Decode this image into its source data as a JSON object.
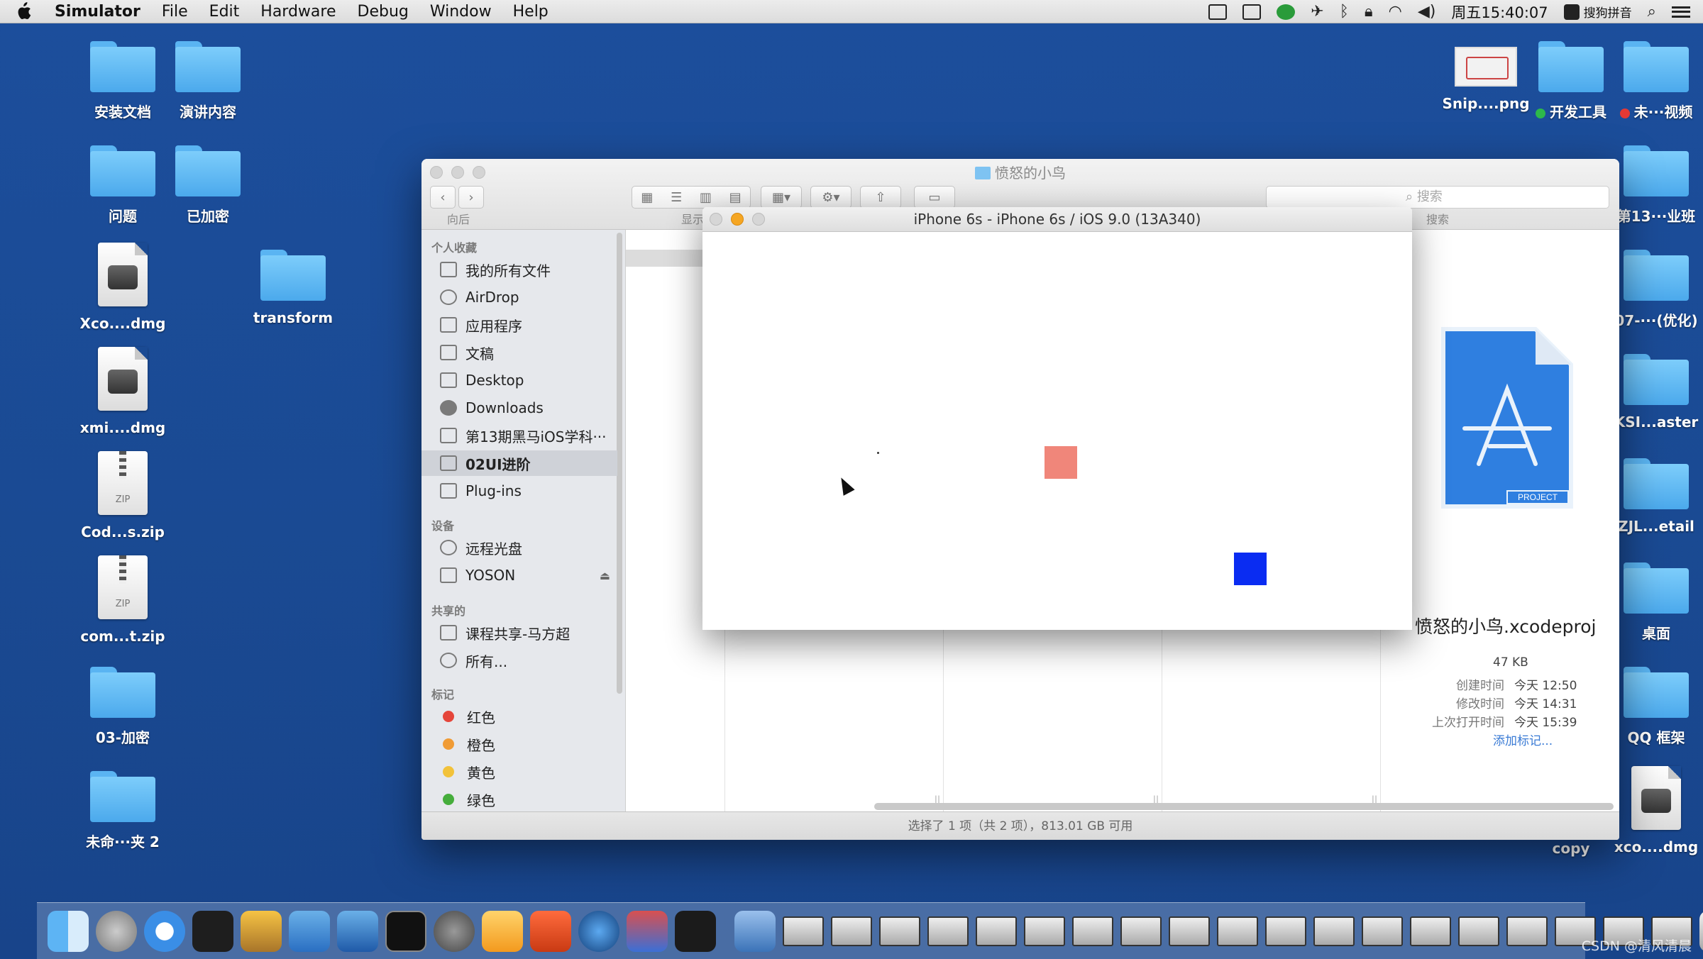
{
  "menubar": {
    "app": "Simulator",
    "items": [
      "File",
      "Edit",
      "Hardware",
      "Debug",
      "Window",
      "Help"
    ],
    "clock": "周五15:40:07",
    "input_method": "搜狗拼音"
  },
  "desktop": {
    "left_icons": [
      {
        "label": "安装文档",
        "kind": "folder"
      },
      {
        "label": "演讲内容",
        "kind": "folder"
      },
      {
        "label": "问题",
        "kind": "folder"
      },
      {
        "label": "已加密",
        "kind": "folder"
      },
      {
        "label": "Xco....dmg",
        "kind": "dmg"
      },
      {
        "label": "transform",
        "kind": "folder"
      },
      {
        "label": "xmi....dmg",
        "kind": "dmg"
      },
      {
        "label": "Cod...s.zip",
        "kind": "zip"
      },
      {
        "label": "com...t.zip",
        "kind": "zip"
      },
      {
        "label": "03-加密",
        "kind": "folder"
      },
      {
        "label": "未命···夹 2",
        "kind": "folder"
      }
    ],
    "right_icons": [
      {
        "label": "Snip....png",
        "kind": "image"
      },
      {
        "label": "开发工具",
        "kind": "folder",
        "tag": "#2db84a"
      },
      {
        "label": "未···视频",
        "kind": "folder",
        "tag": "#e53935"
      },
      {
        "label": "第13···业班",
        "kind": "folder"
      },
      {
        "label": "07-···(优化)",
        "kind": "folder"
      },
      {
        "label": "KSI...aster",
        "kind": "folder"
      },
      {
        "label": "ZJL...etail",
        "kind": "folder"
      },
      {
        "label": "桌面",
        "kind": "folder"
      },
      {
        "label": "QQ 框架",
        "kind": "folder"
      },
      {
        "label": "copy",
        "kind": "none"
      },
      {
        "label": "xco....dmg",
        "kind": "dmg"
      }
    ]
  },
  "finder": {
    "title": "愤怒的小鸟",
    "toolbar": {
      "back_forward_label": "向后",
      "view_label": "显示",
      "search_label": "搜索",
      "search_placeholder": "搜索"
    },
    "sidebar": {
      "sections": [
        "个人收藏",
        "设备",
        "共享的",
        "标记"
      ],
      "favorites": [
        "我的所有文件",
        "AirDrop",
        "应用程序",
        "文稿",
        "Desktop",
        "Downloads",
        "第13期黑马iOS学科···",
        "02UI进阶",
        "Plug-ins"
      ],
      "devices": [
        "远程光盘",
        "YOSON"
      ],
      "shared": [
        "课程共享-马方超",
        "所有..."
      ],
      "tags": [
        {
          "label": "红色",
          "color": "#e5453a"
        },
        {
          "label": "橙色",
          "color": "#f09b35"
        },
        {
          "label": "黄色",
          "color": "#f2c23a"
        },
        {
          "label": "绿色",
          "color": "#45ad3c"
        }
      ],
      "selected": "02UI进阶"
    },
    "preview": {
      "name": "愤怒的小鸟.xcodeproj",
      "size": "47 KB",
      "meta": [
        {
          "key": "创建时间",
          "value": "今天 12:50"
        },
        {
          "key": "修改时间",
          "value": "今天 14:31"
        },
        {
          "key": "上次打开时间",
          "value": "今天 15:39"
        }
      ],
      "add_tag": "添加标记...",
      "icon_badge": "PROJECT"
    },
    "status": "选择了 1 项（共 2 项），813.01 GB 可用"
  },
  "simulator": {
    "title": "iPhone 6s - iPhone 6s / iOS 9.0 (13A340)",
    "squares": [
      {
        "name": "salmon-square",
        "color": "#f0867a"
      },
      {
        "name": "blue-square",
        "color": "#0a2cf2"
      }
    ]
  },
  "watermark": "CSDN @清风清晨"
}
